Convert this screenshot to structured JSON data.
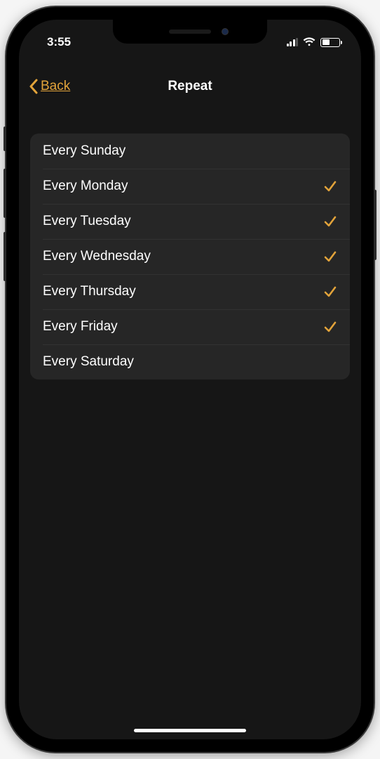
{
  "status": {
    "time": "3:55"
  },
  "nav": {
    "back_label": "Back",
    "title": "Repeat"
  },
  "days": [
    {
      "label": "Every Sunday",
      "selected": false
    },
    {
      "label": "Every Monday",
      "selected": true
    },
    {
      "label": "Every Tuesday",
      "selected": true
    },
    {
      "label": "Every Wednesday",
      "selected": true
    },
    {
      "label": "Every Thursday",
      "selected": true
    },
    {
      "label": "Every Friday",
      "selected": true
    },
    {
      "label": "Every Saturday",
      "selected": false
    }
  ],
  "colors": {
    "accent": "#e2a33a",
    "background": "#161616",
    "card": "#262626"
  }
}
